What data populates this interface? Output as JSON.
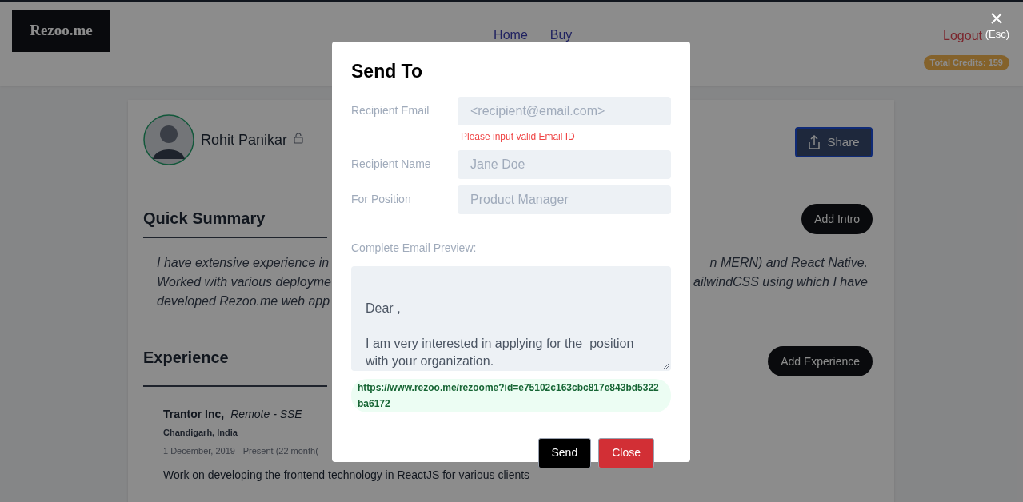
{
  "header": {
    "logo": "Rezoo.me",
    "nav": [
      {
        "label": "Home"
      },
      {
        "label": "Buy"
      }
    ],
    "logout": "Logout",
    "credits": "Total Credits: 159"
  },
  "profile": {
    "name": "Rohit Panikar",
    "share": "Share"
  },
  "summary": {
    "title": "Quick Summary",
    "button": "Add Intro",
    "lines": [
      {
        "left": "I have extensive experience in",
        "right": "n MERN) and React Native."
      },
      {
        "left": "Worked with various deployme",
        "right": "ailwindCSS using which I have"
      },
      {
        "left": "developed Rezoo.me web app"
      }
    ]
  },
  "experience": {
    "title": "Experience",
    "button": "Add Experience",
    "items": [
      {
        "company": "Trantor Inc,",
        "role": "Remote - SSE",
        "location": "Chandigarh, India",
        "dates": "1 December, 2019 - Present (22 month(",
        "description": "Work on developing the frontend technology in ReactJS for various clients"
      }
    ]
  },
  "dialog": {
    "close_hint": "(Esc)",
    "title": "Send To",
    "fields": [
      {
        "label": "Recipient Email",
        "placeholder": "<recipient@email.com>",
        "error": "Please input valid Email ID"
      },
      {
        "label": "Recipient Name",
        "placeholder": "Jane Doe"
      },
      {
        "label": "For Position",
        "placeholder": "Product Manager"
      }
    ],
    "preview_label": "Complete Email Preview:",
    "preview_paragraphs": [
      {
        "lines": [
          "Dear ,"
        ]
      },
      {
        "lines": [
          "I am very interested in applying for the  position",
          "with your organization."
        ]
      }
    ],
    "link": "https://www.rezoo.me/rezoome?id=e75102c163cbc817e843bd5322ba6172",
    "buttons": [
      {
        "label": "Send",
        "kind": "primary"
      },
      {
        "label": "Close",
        "kind": "danger"
      }
    ]
  }
}
